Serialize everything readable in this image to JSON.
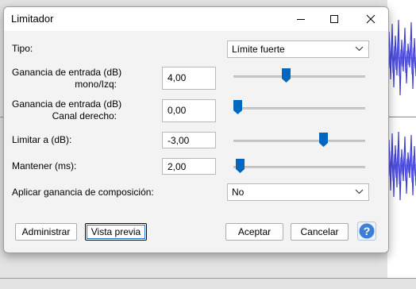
{
  "window": {
    "title": "Limitador",
    "minimize_icon": "minimize-icon",
    "maximize_icon": "maximize-icon",
    "close_icon": "close-icon"
  },
  "fields": {
    "tipo": {
      "label": "Tipo:",
      "value": "Límite fuerte"
    },
    "gain_left": {
      "label_line1": "Ganancia de entrada (dB)",
      "label_line2": "mono/Izq:",
      "value": "4,00",
      "slider_fraction": 0.4
    },
    "gain_right": {
      "label_line1": "Ganancia de entrada (dB)",
      "label_line2": "Canal derecho:",
      "value": "0,00",
      "slider_fraction": 0.03
    },
    "limit": {
      "label": "Limitar a (dB):",
      "value": "-3,00",
      "slider_fraction": 0.68
    },
    "hold": {
      "label": "Mantener (ms):",
      "value": "2,00",
      "slider_fraction": 0.05
    },
    "makeup": {
      "label": "Aplicar ganancia de composición:",
      "value": "No"
    }
  },
  "buttons": {
    "manage": "Administrar",
    "preview": "Vista previa",
    "accept": "Aceptar",
    "cancel": "Cancelar",
    "help_icon": "help-icon"
  },
  "colors": {
    "accent": "#0067c0",
    "help": "#3b7fd9"
  }
}
